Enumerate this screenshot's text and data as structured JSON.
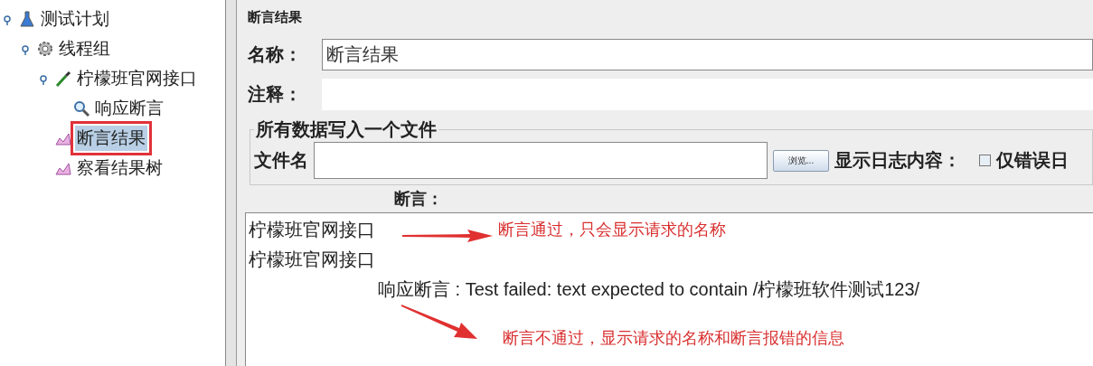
{
  "tree": [
    {
      "label": "测试计划",
      "kind": "plan",
      "selected": false,
      "marked": false,
      "expanded": true,
      "children": [
        {
          "label": "线程组",
          "kind": "threads",
          "selected": false,
          "marked": false,
          "expanded": true,
          "children": [
            {
              "label": "柠檬班官网接口",
              "kind": "sampler",
              "selected": false,
              "marked": false,
              "expanded": true,
              "children": [
                {
                  "label": "响应断言",
                  "kind": "assertion",
                  "selected": false,
                  "marked": false
                }
              ]
            },
            {
              "label": "断言结果",
              "kind": "listener",
              "selected": true,
              "marked": true
            },
            {
              "label": "察看结果树",
              "kind": "listener",
              "selected": false,
              "marked": false
            }
          ]
        }
      ]
    }
  ],
  "panel": {
    "title": "断言结果",
    "name": {
      "label": "名称：",
      "value": "断言结果"
    },
    "comment": {
      "label": "注释："
    },
    "file_group": {
      "legend": "所有数据写入一个文件",
      "filename_label": "文件名",
      "browse_button": "浏览...",
      "log_label": "显示日志内容：",
      "errors_only": {
        "label": "仅错误日",
        "checked": false
      }
    },
    "assertions_label": "断言：",
    "results": [
      {
        "kind": "sample",
        "text": "柠檬班官网接口"
      },
      {
        "kind": "sample",
        "text": "柠檬班官网接口"
      },
      {
        "kind": "failure",
        "text": "响应断言 : Test failed: text expected to contain /柠檬班软件测试123/"
      }
    ]
  },
  "annotations": [
    {
      "text": "断言通过，只会显示请求的名称"
    },
    {
      "text": "断言不通过，显示请求的名称和断言报错的信息"
    }
  ]
}
